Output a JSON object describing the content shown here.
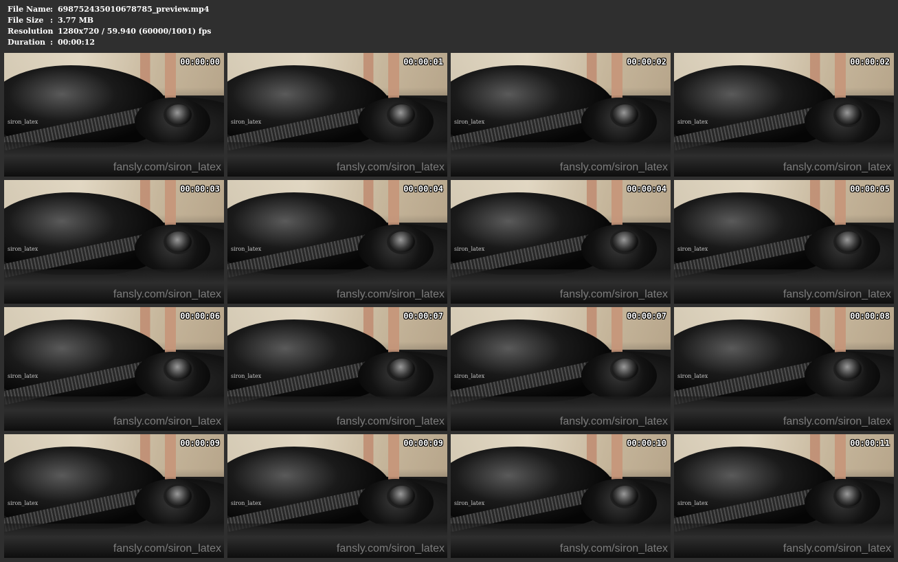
{
  "header": {
    "file_name_label": "File Name",
    "file_name": "698752435010678785_preview.mp4",
    "file_size_label": "File Size",
    "file_size": "3.77 MB",
    "resolution_label": "Resolution",
    "resolution": "1280x720 / 59.940 (60000/1001) fps",
    "duration_label": "Duration",
    "duration": "00:00:12",
    "separator": ":"
  },
  "watermarks": {
    "small": "siron_latex",
    "large": "fansly.com/siron_latex"
  },
  "thumbnails": [
    {
      "timestamp": "00:00:00"
    },
    {
      "timestamp": "00:00:01"
    },
    {
      "timestamp": "00:00:02"
    },
    {
      "timestamp": "00:00:02"
    },
    {
      "timestamp": "00:00:03"
    },
    {
      "timestamp": "00:00:04"
    },
    {
      "timestamp": "00:00:04"
    },
    {
      "timestamp": "00:00:05"
    },
    {
      "timestamp": "00:00:06"
    },
    {
      "timestamp": "00:00:07"
    },
    {
      "timestamp": "00:00:07"
    },
    {
      "timestamp": "00:00:08"
    },
    {
      "timestamp": "00:00:09"
    },
    {
      "timestamp": "00:00:09"
    },
    {
      "timestamp": "00:00:10"
    },
    {
      "timestamp": "00:00:11"
    }
  ]
}
